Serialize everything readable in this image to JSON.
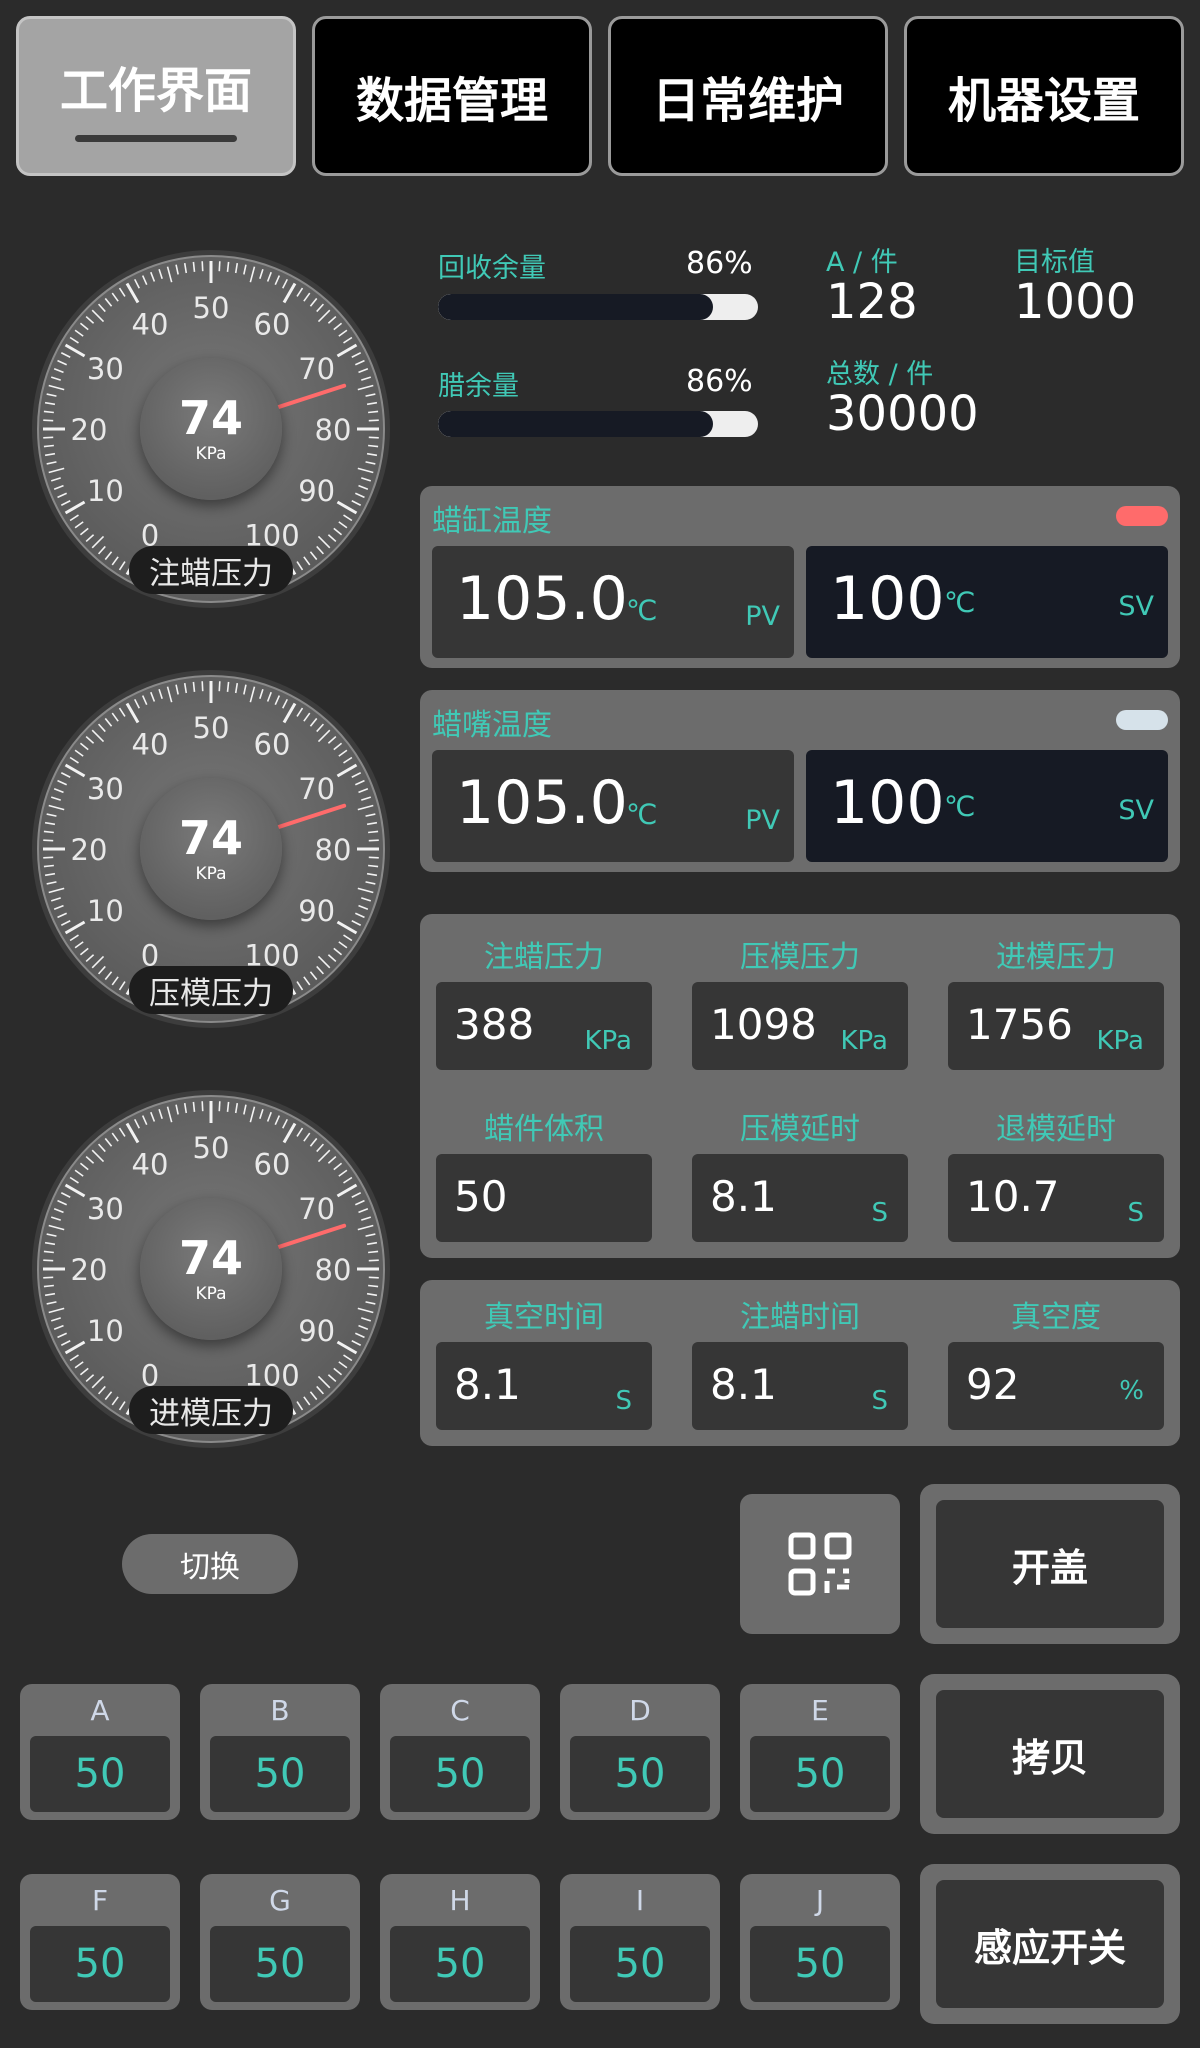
{
  "tabs": [
    {
      "label": "工作界面"
    },
    {
      "label": "数据管理"
    },
    {
      "label": "日常维护"
    },
    {
      "label": "机器设置"
    }
  ],
  "gauges": [
    {
      "value": "74",
      "unit": "KPa",
      "label": "注蜡压力",
      "needle_value": 74
    },
    {
      "value": "74",
      "unit": "KPa",
      "label": "压模压力",
      "needle_value": 74
    },
    {
      "value": "74",
      "unit": "KPa",
      "label": "进模压力",
      "needle_value": 74
    }
  ],
  "gauge_ticks": [
    "0",
    "10",
    "20",
    "30",
    "40",
    "50",
    "60",
    "70",
    "80",
    "90",
    "100"
  ],
  "levels": [
    {
      "label": "回收余量",
      "percent_text": "86%",
      "percent": 86
    },
    {
      "label": "腊余量",
      "percent_text": "86%",
      "percent": 86
    }
  ],
  "counters": {
    "a_label": "A / 件",
    "a_value": "128",
    "target_label": "目标值",
    "target_value": "1000",
    "total_label": "总数 / 件",
    "total_value": "30000"
  },
  "temps": [
    {
      "title": "蜡缸温度",
      "pv": "105.0",
      "pv_unit": "℃",
      "pv_tag": "PV",
      "sv": "100",
      "sv_unit": "℃",
      "sv_tag": "SV",
      "indicator_color": "#ff6b6b"
    },
    {
      "title": "蜡嘴温度",
      "pv": "105.0",
      "pv_unit": "℃",
      "pv_tag": "PV",
      "sv": "100",
      "sv_unit": "℃",
      "sv_tag": "SV",
      "indicator_color": "#d6e2ea"
    }
  ],
  "params": [
    {
      "label": "注蜡压力",
      "value": "388",
      "unit": "KPa"
    },
    {
      "label": "压模压力",
      "value": "1098",
      "unit": "KPa"
    },
    {
      "label": "进模压力",
      "value": "1756",
      "unit": "KPa"
    },
    {
      "label": "蜡件体积",
      "value": "50",
      "unit": ""
    },
    {
      "label": "压模延时",
      "value": "8.1",
      "unit": "S"
    },
    {
      "label": "退模延时",
      "value": "10.7",
      "unit": "S"
    }
  ],
  "times": [
    {
      "label": "真空时间",
      "value": "8.1",
      "unit": "S"
    },
    {
      "label": "注蜡时间",
      "value": "8.1",
      "unit": "S"
    },
    {
      "label": "真空度",
      "value": "92",
      "unit": "%"
    }
  ],
  "switch_button": "切换",
  "qr_icon": "qr-code-icon",
  "actions": {
    "open_lid": "开盖",
    "copy": "拷贝",
    "sensor_switch": "感应开关"
  },
  "channels": [
    {
      "label": "A",
      "value": "50"
    },
    {
      "label": "B",
      "value": "50"
    },
    {
      "label": "C",
      "value": "50"
    },
    {
      "label": "D",
      "value": "50"
    },
    {
      "label": "E",
      "value": "50"
    },
    {
      "label": "F",
      "value": "50"
    },
    {
      "label": "G",
      "value": "50"
    },
    {
      "label": "H",
      "value": "50"
    },
    {
      "label": "I",
      "value": "50"
    },
    {
      "label": "J",
      "value": "50"
    }
  ],
  "colors": {
    "accent": "#40c9b6",
    "needle": "#ff6b6b",
    "background": "#2b2b2b",
    "panel": "#6c6c6c"
  }
}
